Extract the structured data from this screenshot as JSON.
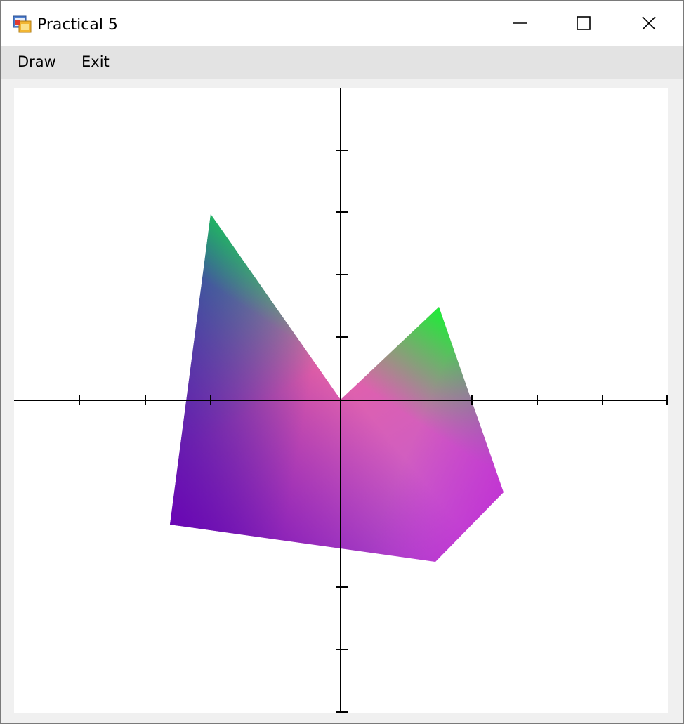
{
  "window": {
    "title": "Practical 5",
    "icon": "app-form-icon",
    "controls": {
      "minimize_icon": "minimize-icon",
      "maximize_icon": "maximize-icon",
      "close_icon": "close-icon"
    }
  },
  "menu": {
    "items": [
      {
        "label": "Draw"
      },
      {
        "label": "Exit"
      }
    ]
  },
  "canvas": {
    "background": "#ffffff",
    "axis_color": "#000000",
    "tick_count_per_half_axis": 4,
    "polygon": {
      "description_colors": {
        "top_left_vertex": "#23b074",
        "top_right_vertex": "#1aee36",
        "left_bottom_vertex": "#6a05b4",
        "bottom_right_vertex": "#c457d4",
        "center_vertex": "#ee5fa4",
        "right_vertex": "#c22fd2"
      }
    }
  }
}
